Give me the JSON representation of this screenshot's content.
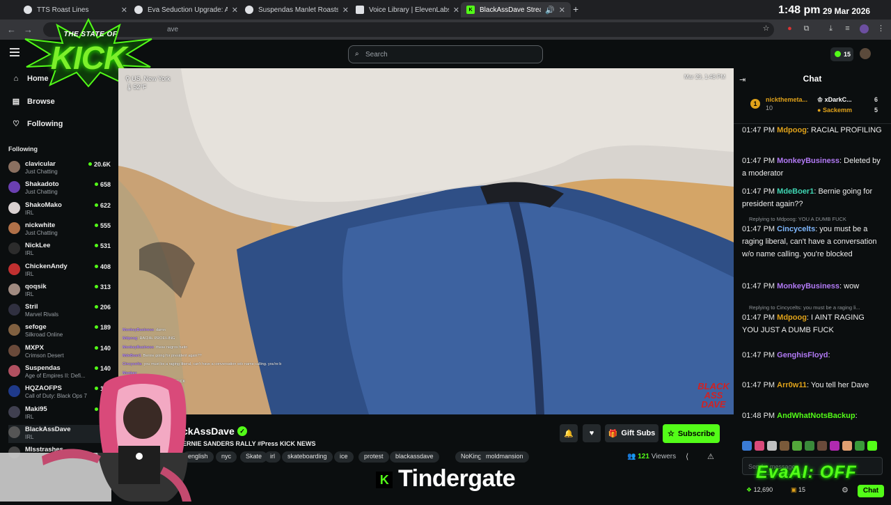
{
  "browser": {
    "tabs": [
      {
        "title": "TTS Roast Lines"
      },
      {
        "title": "Eva Seduction Upgrade: Archet"
      },
      {
        "title": "Suspendas Manlet Roasts & Th"
      },
      {
        "title": "Voice Library | ElevenLabs"
      },
      {
        "title": "BlackAssDave Stream - Wat"
      }
    ],
    "time": "1:48 pm",
    "date": "29 Mar 2026",
    "url_fragment": "ave"
  },
  "header": {
    "search_placeholder": "Search",
    "kicks_count": "15"
  },
  "logo": {
    "top": "THE STATE OF",
    "main": "KICK"
  },
  "sidebar": {
    "nav": [
      {
        "label": "Home",
        "icon": "home-icon"
      },
      {
        "label": "Browse",
        "icon": "browse-icon"
      },
      {
        "label": "Following",
        "icon": "heart-icon"
      }
    ],
    "following_header": "Following",
    "following": [
      {
        "name": "clavicular",
        "category": "Just Chatting",
        "viewers": "20.6K",
        "color": "#8a7060"
      },
      {
        "name": "Shakadoto",
        "category": "Just Chatting",
        "viewers": "658",
        "color": "#6a3fb0"
      },
      {
        "name": "ShakoMako",
        "category": "IRL",
        "viewers": "622",
        "color": "#d8d0d0"
      },
      {
        "name": "nickwhite",
        "category": "Just Chatting",
        "viewers": "555",
        "color": "#b07048"
      },
      {
        "name": "NickLee",
        "category": "IRL",
        "viewers": "531",
        "color": "#2c2c2c"
      },
      {
        "name": "ChickenAndy",
        "category": "IRL",
        "viewers": "408",
        "color": "#c03030"
      },
      {
        "name": "qoqsik",
        "category": "IRL",
        "viewers": "313",
        "color": "#a08a80"
      },
      {
        "name": "Stril",
        "category": "Marvel Rivals",
        "viewers": "206",
        "color": "#303040"
      },
      {
        "name": "sefoge",
        "category": "Silkroad Online",
        "viewers": "189",
        "color": "#806040"
      },
      {
        "name": "MXPX",
        "category": "Crimson Desert",
        "viewers": "140",
        "color": "#6a4a3a"
      },
      {
        "name": "Suspendas",
        "category": "Age of Empires II: Defi...",
        "viewers": "140",
        "color": "#b05060"
      },
      {
        "name": "HQZAOFPS",
        "category": "Call of Duty: Black Ops 7",
        "viewers": "132",
        "color": "#1f3a8a"
      },
      {
        "name": "Maki95",
        "category": "IRL",
        "viewers": "132",
        "color": "#404050"
      },
      {
        "name": "BlackAssDave",
        "category": "IRL",
        "viewers": "",
        "color": "#555555"
      },
      {
        "name": "Mlsstrashes",
        "category": "",
        "viewers": "",
        "color": "#444444"
      }
    ]
  },
  "video": {
    "location": "US, New York",
    "temperature": "52°F",
    "timestamp": "Mar 29, 1:48 PM",
    "watermark": "BLACK ASS DAVE",
    "overlay_chat": [
      {
        "user": "MonkeyBusiness",
        "text": ": damn"
      },
      {
        "user": "Mdpoog",
        "text": ": RACIAL PROFILING"
      },
      {
        "user": "MonkeyBusiness",
        "text": ": these negros hatin"
      },
      {
        "user": "MdeBoer1",
        "text": ": Bernie going for president again??"
      },
      {
        "user": "Cincycelts",
        "text": ": you must be a raging liberal, can't have a conversation w/o name calling. you're b"
      },
      {
        "user": "Monkey",
        "text": ""
      },
      {
        "user": "Mdpoog",
        "text": ": YOU JUST A DUMB FUCK"
      }
    ]
  },
  "stream": {
    "name": "BlackAssDave",
    "name_visible": "ckAssDave",
    "title": "ERNIE SANDERS RALLY #Press KICK NEWS",
    "tags": [
      "english",
      "nyc",
      "Skate",
      "irl",
      "skateboarding",
      "ice",
      "protest",
      "blackassdave",
      "NoKings",
      "moldmansion"
    ],
    "gift_label": "Gift Subs",
    "subscribe_label": "Subscribe",
    "viewers": "121",
    "viewers_label": "Viewers",
    "banner": "Tindergate",
    "banner_icon": "K"
  },
  "chat": {
    "title": "Chat",
    "leaderboard": [
      {
        "name": "nickthemeta...",
        "count": "10",
        "rank": "1"
      },
      {
        "name": "xDarkC...",
        "count": "6"
      },
      {
        "name": "Sackemm",
        "count": "5"
      }
    ],
    "messages": [
      {
        "time": "01:47 PM",
        "user": "Mdpoog",
        "color": "#e0a21a",
        "text": ": RACIAL PROFILING"
      },
      {
        "time": "01:47 PM",
        "user": "MonkeyBusiness",
        "color": "#b27af5",
        "text": ": Deleted by a moderator"
      },
      {
        "time": "01:47 PM",
        "user": "MdeBoer1",
        "color": "#3fd6b3",
        "text": ": Bernie going for president again??"
      },
      {
        "time": "01:47 PM",
        "user": "Cincycelts",
        "color": "#7fb8ff",
        "text": ": you must be a raging liberal, can't have a conversation w/o name calling. you're blocked",
        "reply": "Replying to Mdpoog: YOU A DUMB FUCK"
      },
      {
        "time": "01:47 PM",
        "user": "MonkeyBusiness",
        "color": "#b27af5",
        "text": ": wow"
      },
      {
        "time": "01:47 PM",
        "user": "Mdpoog",
        "color": "#e0a21a",
        "text": ": I AINT RAGING YOU JUST A DUMB FUCK",
        "reply": "Replying to Cincycelts: you must be a raging li..."
      },
      {
        "time": "01:47 PM",
        "user": "GenghisFloyd",
        "color": "#b27af5",
        "text": ":"
      },
      {
        "time": "01:47 PM",
        "user": "Arr0w11",
        "color": "#e0a21a",
        "text": ": You tell her Dave"
      },
      {
        "time": "01:48 PM",
        "user": "AndWhatNotsBackup",
        "color": "#53fc18",
        "text": ":"
      }
    ],
    "input_placeholder": "Send a message",
    "eva_overlay": "EvaAI: OFF",
    "points": "12,690",
    "points2": "15",
    "send_label": "Chat"
  }
}
